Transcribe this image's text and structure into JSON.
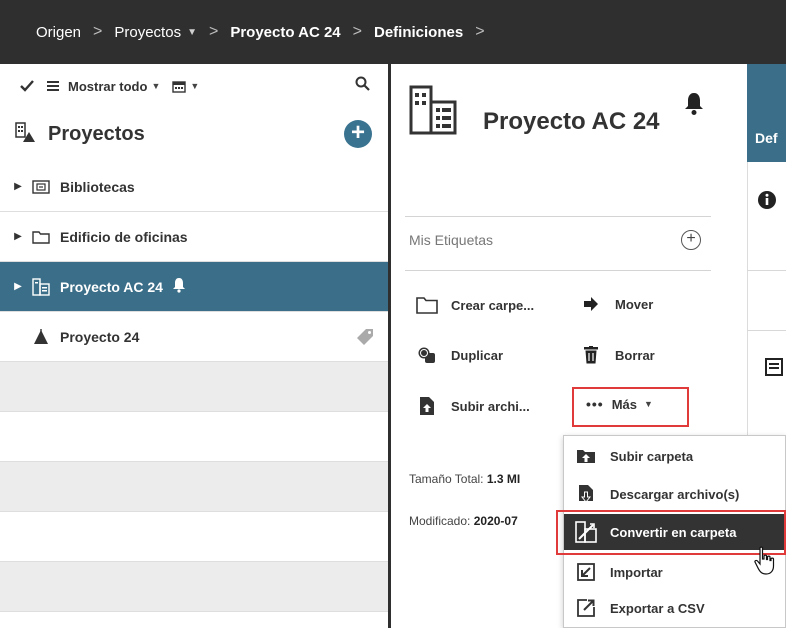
{
  "breadcrumb": {
    "items": [
      {
        "label": "Origen"
      },
      {
        "label": "Proyectos"
      },
      {
        "label": "Proyecto AC 24"
      },
      {
        "label": "Definiciones"
      }
    ]
  },
  "left_toolbar": {
    "filter_label": "Mostrar todo"
  },
  "left": {
    "title": "Proyectos",
    "tree": [
      {
        "label": "Bibliotecas"
      },
      {
        "label": "Edificio de oficinas"
      },
      {
        "label": "Proyecto AC 24"
      },
      {
        "label": "Proyecto 24"
      }
    ]
  },
  "detail": {
    "title": "Proyecto AC 24",
    "tags_label": "Mis Etiquetas",
    "actions": {
      "create_folder": "Crear carpe...",
      "move": "Mover",
      "duplicate": "Duplicar",
      "delete": "Borrar",
      "upload_file": "Subir archi...",
      "more": "Más"
    },
    "size_label": "Tamaño Total:",
    "size_value": "1.3 MI",
    "modified_label": "Modificado:",
    "modified_value": "2020-07"
  },
  "right": {
    "tab_label": "Def"
  },
  "menu": {
    "items": [
      {
        "label": "Subir carpeta"
      },
      {
        "label": "Descargar archivo(s)"
      },
      {
        "label": "Convertir en carpeta"
      },
      {
        "label": "Importar"
      },
      {
        "label": "Exportar a CSV"
      }
    ]
  },
  "colors": {
    "topbar": "#2f2f2f",
    "accent": "#3b6e88",
    "highlight_border": "#e03a3a"
  }
}
